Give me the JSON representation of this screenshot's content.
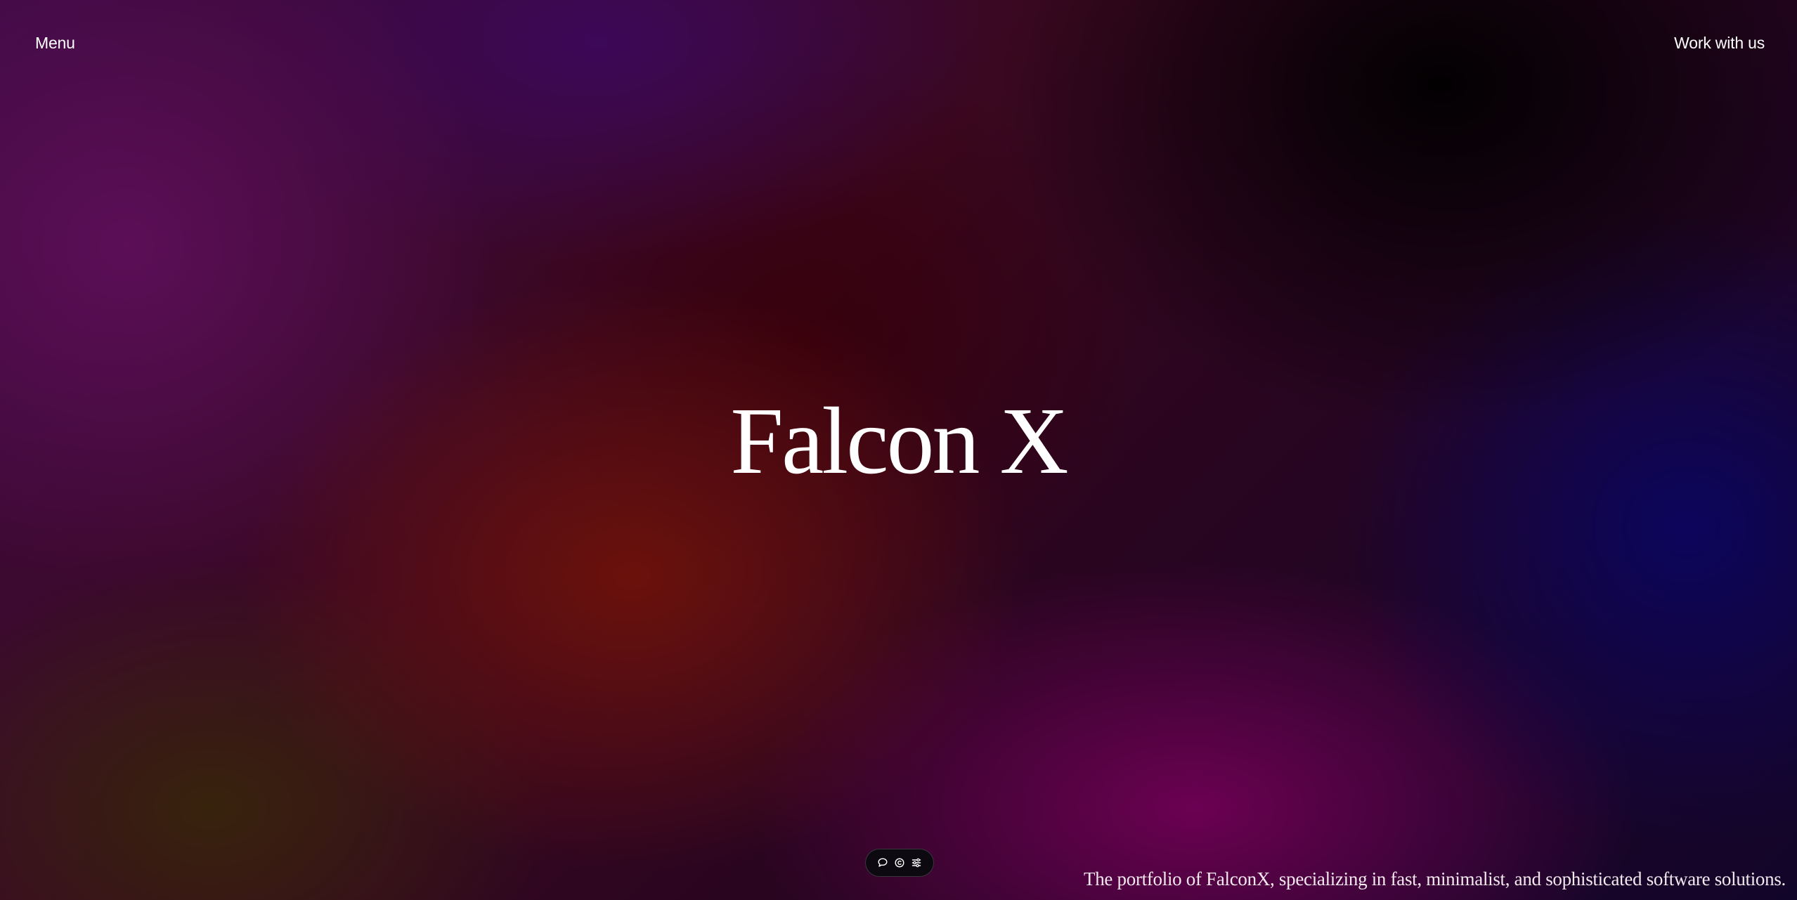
{
  "header": {
    "menu_label": "Menu",
    "cta_label": "Work with us"
  },
  "hero": {
    "title": "Falcon X"
  },
  "toolbar": {
    "icons": [
      "chat-bubble-icon",
      "copyright-icon",
      "sliders-icon"
    ]
  },
  "footer": {
    "tagline": "The portfolio of FalconX, specializing in fast, minimalist, and sophisticated software solutions."
  },
  "colors": {
    "text": "#ffffff",
    "toolbar_bg": "#0c0a10"
  }
}
